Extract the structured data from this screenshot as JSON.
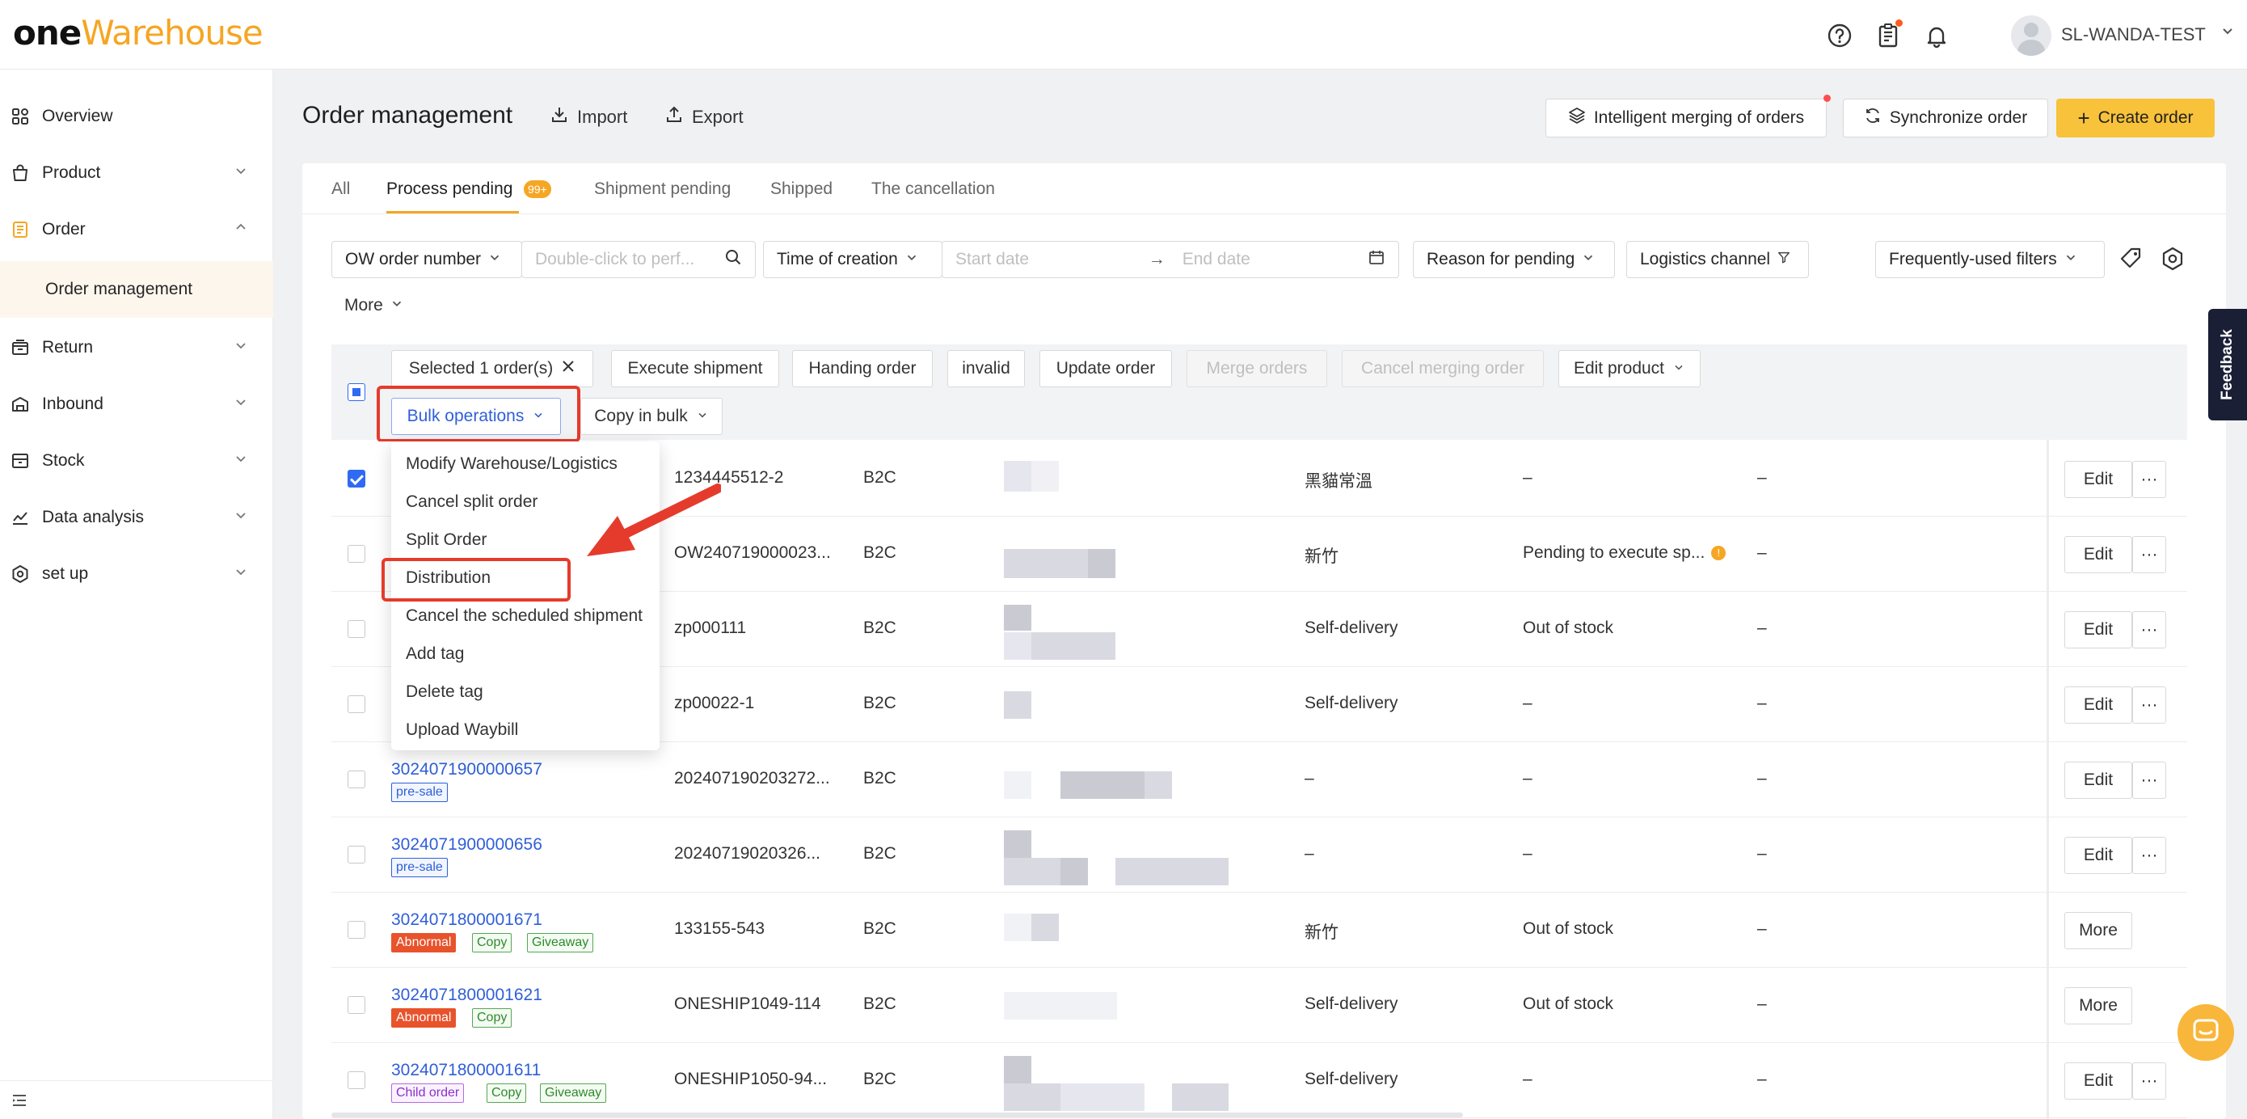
{
  "header": {
    "logo_one": "one",
    "logo_warehouse": "Warehouse",
    "username": "SL-WANDA-TEST"
  },
  "sidebar": {
    "items": [
      {
        "label": "Overview"
      },
      {
        "label": "Product"
      },
      {
        "label": "Order"
      },
      {
        "label": "Order management"
      },
      {
        "label": "Return"
      },
      {
        "label": "Inbound"
      },
      {
        "label": "Stock"
      },
      {
        "label": "Data analysis"
      },
      {
        "label": "set up"
      }
    ]
  },
  "page": {
    "title": "Order management",
    "import_label": "Import",
    "export_label": "Export",
    "intelligent_merge_label": "Intelligent merging of orders",
    "sync_label": "Synchronize order",
    "create_label": "Create order"
  },
  "tabs": [
    {
      "label": "All"
    },
    {
      "label": "Process pending",
      "badge": "99+"
    },
    {
      "label": "Shipment pending"
    },
    {
      "label": "Shipped"
    },
    {
      "label": "The cancellation"
    }
  ],
  "filters": {
    "order_number_select": "OW order number",
    "order_number_placeholder": "Double-click to perf...",
    "time_select": "Time of creation",
    "start_placeholder": "Start date",
    "end_placeholder": "End date",
    "reason_select": "Reason for pending",
    "logistics_select": "Logistics channel",
    "frequent_filters": "Frequently-used filters",
    "more": "More"
  },
  "toolbar": {
    "selected": "Selected 1 order(s)",
    "execute_shipment": "Execute shipment",
    "handing_order": "Handing order",
    "invalid": "invalid",
    "update_order": "Update order",
    "merge_orders": "Merge orders",
    "cancel_merging": "Cancel merging order",
    "edit_product": "Edit product",
    "bulk_operations": "Bulk operations",
    "copy_in_bulk": "Copy in bulk"
  },
  "bulk_menu": [
    "Modify Warehouse/Logistics",
    "Cancel split order",
    "Split Order",
    "Distribution",
    "Cancel the scheduled shipment",
    "Add tag",
    "Delete tag",
    "Upload Waybill"
  ],
  "rows": [
    {
      "order": "",
      "tags": [],
      "ref": "1234445512-2",
      "type": "B2C",
      "warehouse": "黑貓常溫",
      "reason": "–",
      "extra": "–",
      "action": "Edit"
    },
    {
      "order": "",
      "tags": [],
      "ref": "OW240719000023...",
      "type": "B2C",
      "warehouse": "新竹",
      "reason": "Pending to execute sp...",
      "extra": "–",
      "action": "Edit"
    },
    {
      "order": "",
      "tags": [],
      "ref": "zp000111",
      "type": "B2C",
      "warehouse": "Self-delivery",
      "reason": "Out of stock",
      "extra": "–",
      "action": "Edit"
    },
    {
      "order": "",
      "tags": [],
      "ref": "zp00022-1",
      "type": "B2C",
      "warehouse": "Self-delivery",
      "reason": "–",
      "extra": "–",
      "action": "Edit"
    },
    {
      "order": "3024071900000657",
      "tags": [
        "pre-sale"
      ],
      "ref": "202407190203272...",
      "type": "B2C",
      "warehouse": "–",
      "reason": "–",
      "extra": "–",
      "action": "Edit"
    },
    {
      "order": "3024071900000656",
      "tags": [
        "pre-sale"
      ],
      "ref": "20240719020326...",
      "type": "B2C",
      "warehouse": "–",
      "reason": "–",
      "extra": "–",
      "action": "Edit"
    },
    {
      "order": "3024071800001671",
      "tags": [
        "Abnormal",
        "Copy",
        "Giveaway"
      ],
      "ref": "133155-543",
      "type": "B2C",
      "warehouse": "新竹",
      "reason": "Out of stock",
      "extra": "–",
      "action": "More"
    },
    {
      "order": "3024071800001621",
      "tags": [
        "Abnormal",
        "Copy"
      ],
      "ref": "ONESHIP1049-114",
      "type": "B2C",
      "warehouse": "Self-delivery",
      "reason": "Out of stock",
      "extra": "–",
      "action": "More"
    },
    {
      "order": "3024071800001611",
      "tags": [
        "Child order",
        "Copy",
        "Giveaway"
      ],
      "ref": "ONESHIP1050-94...",
      "type": "B2C",
      "warehouse": "Self-delivery",
      "reason": "–",
      "extra": "–",
      "action": "Edit"
    }
  ],
  "more_dots": "···",
  "feedback": "Feedback",
  "colors": {
    "accent": "#f5a623",
    "primary_button": "#f8c23a",
    "link": "#2f5fd8",
    "highlight": "#e53b2c"
  }
}
